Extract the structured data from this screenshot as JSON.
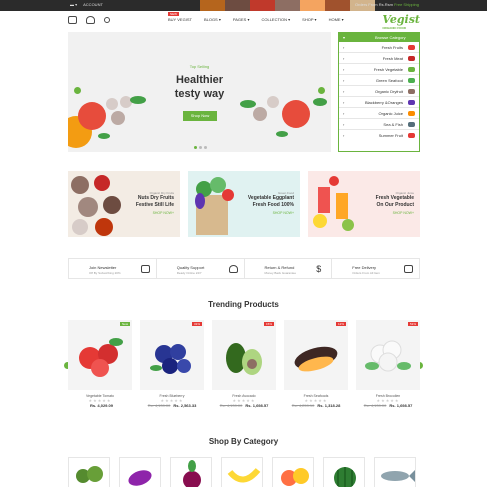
{
  "topbar": {
    "account_label": "ACCOUNT",
    "promo_prefix": "Orders From Rs.Rsm",
    "promo_highlight": "Free Shipping"
  },
  "header": {
    "nav": [
      {
        "label": "BUY VEGIST",
        "badge": "NEW"
      },
      {
        "label": "BLOGS"
      },
      {
        "label": "PAGES"
      },
      {
        "label": "COLLECTION"
      },
      {
        "label": "SHOP"
      },
      {
        "label": "HOME"
      }
    ],
    "logo": "Vegist",
    "logo_tagline": "ORGANIC FOOD"
  },
  "hero": {
    "tag": "Top Selling",
    "title_line1": "Healthier",
    "title_line2": "testy way",
    "button": "Shop Now"
  },
  "category": {
    "heading": "Browse Category",
    "items": [
      {
        "label": "Fresh Fruits",
        "color": "#e53935"
      },
      {
        "label": "Fresh Meat",
        "color": "#c62828"
      },
      {
        "label": "Fresh Vegetable",
        "color": "#6ab43e"
      },
      {
        "label": "Green Seafood",
        "color": "#4caf50"
      },
      {
        "label": "Organic Dryfruit",
        "color": "#8d6e63"
      },
      {
        "label": "Blackberry &Oranges",
        "color": "#5e35b1"
      },
      {
        "label": "Organic Juice",
        "color": "#fb8c00"
      },
      {
        "label": "Sea & Fish",
        "color": "#546e7a"
      },
      {
        "label": "Summer Fruit",
        "color": "#e53935"
      }
    ]
  },
  "banners": [
    {
      "small": "Organic Dry Fruits",
      "line1": "Nuts Dry Fruits",
      "line2": "Festive Still Life",
      "link": "SHOP NOW+"
    },
    {
      "small": "Green Food",
      "line1": "Vegetable Eggplant",
      "line2": "Fresh Food 100%",
      "link": "SHOP NOW+"
    },
    {
      "small": "Organic Juice",
      "line1": "Fresh Vegetable",
      "line2": "On Our Product",
      "link": "SHOP NOW+"
    }
  ],
  "features": [
    {
      "title": "Join Newsletter",
      "sub": "Off By Subscribing 20%"
    },
    {
      "title": "Quality Support",
      "sub": "Ready Online 24/7"
    },
    {
      "title": "Return & Refund",
      "sub": "Money Back Guarantee"
    },
    {
      "title": "Free Delivery",
      "sub": "Orders From All Item"
    }
  ],
  "trending": {
    "title": "Trending Products",
    "items": [
      {
        "name": "Vegetable Tomato",
        "old": "",
        "price": "Rs. 4,029.09",
        "badge": "New",
        "badge_type": "new"
      },
      {
        "name": "Fresh Blueberry",
        "old": "Rs. 4,139.00",
        "price": "Rs. 2,563.33",
        "badge": "31%",
        "badge_type": "disc"
      },
      {
        "name": "Fresh Avocado",
        "old": "Rs. 4,139.00",
        "price": "Rs. 1,698.57",
        "badge": "15%",
        "badge_type": "disc"
      },
      {
        "name": "Fresh Seafoods",
        "old": "Rs. 4,259.10",
        "price": "Rs. 1,318.28",
        "badge": "12%",
        "badge_type": "disc"
      },
      {
        "name": "Fresh Brocolien",
        "old": "Rs. 4,139.00",
        "price": "Rs. 1,698.57",
        "badge": "51%",
        "badge_type": "disc"
      }
    ],
    "stars": "★★★★★"
  },
  "shop_by_category": {
    "title": "Shop By Category"
  }
}
